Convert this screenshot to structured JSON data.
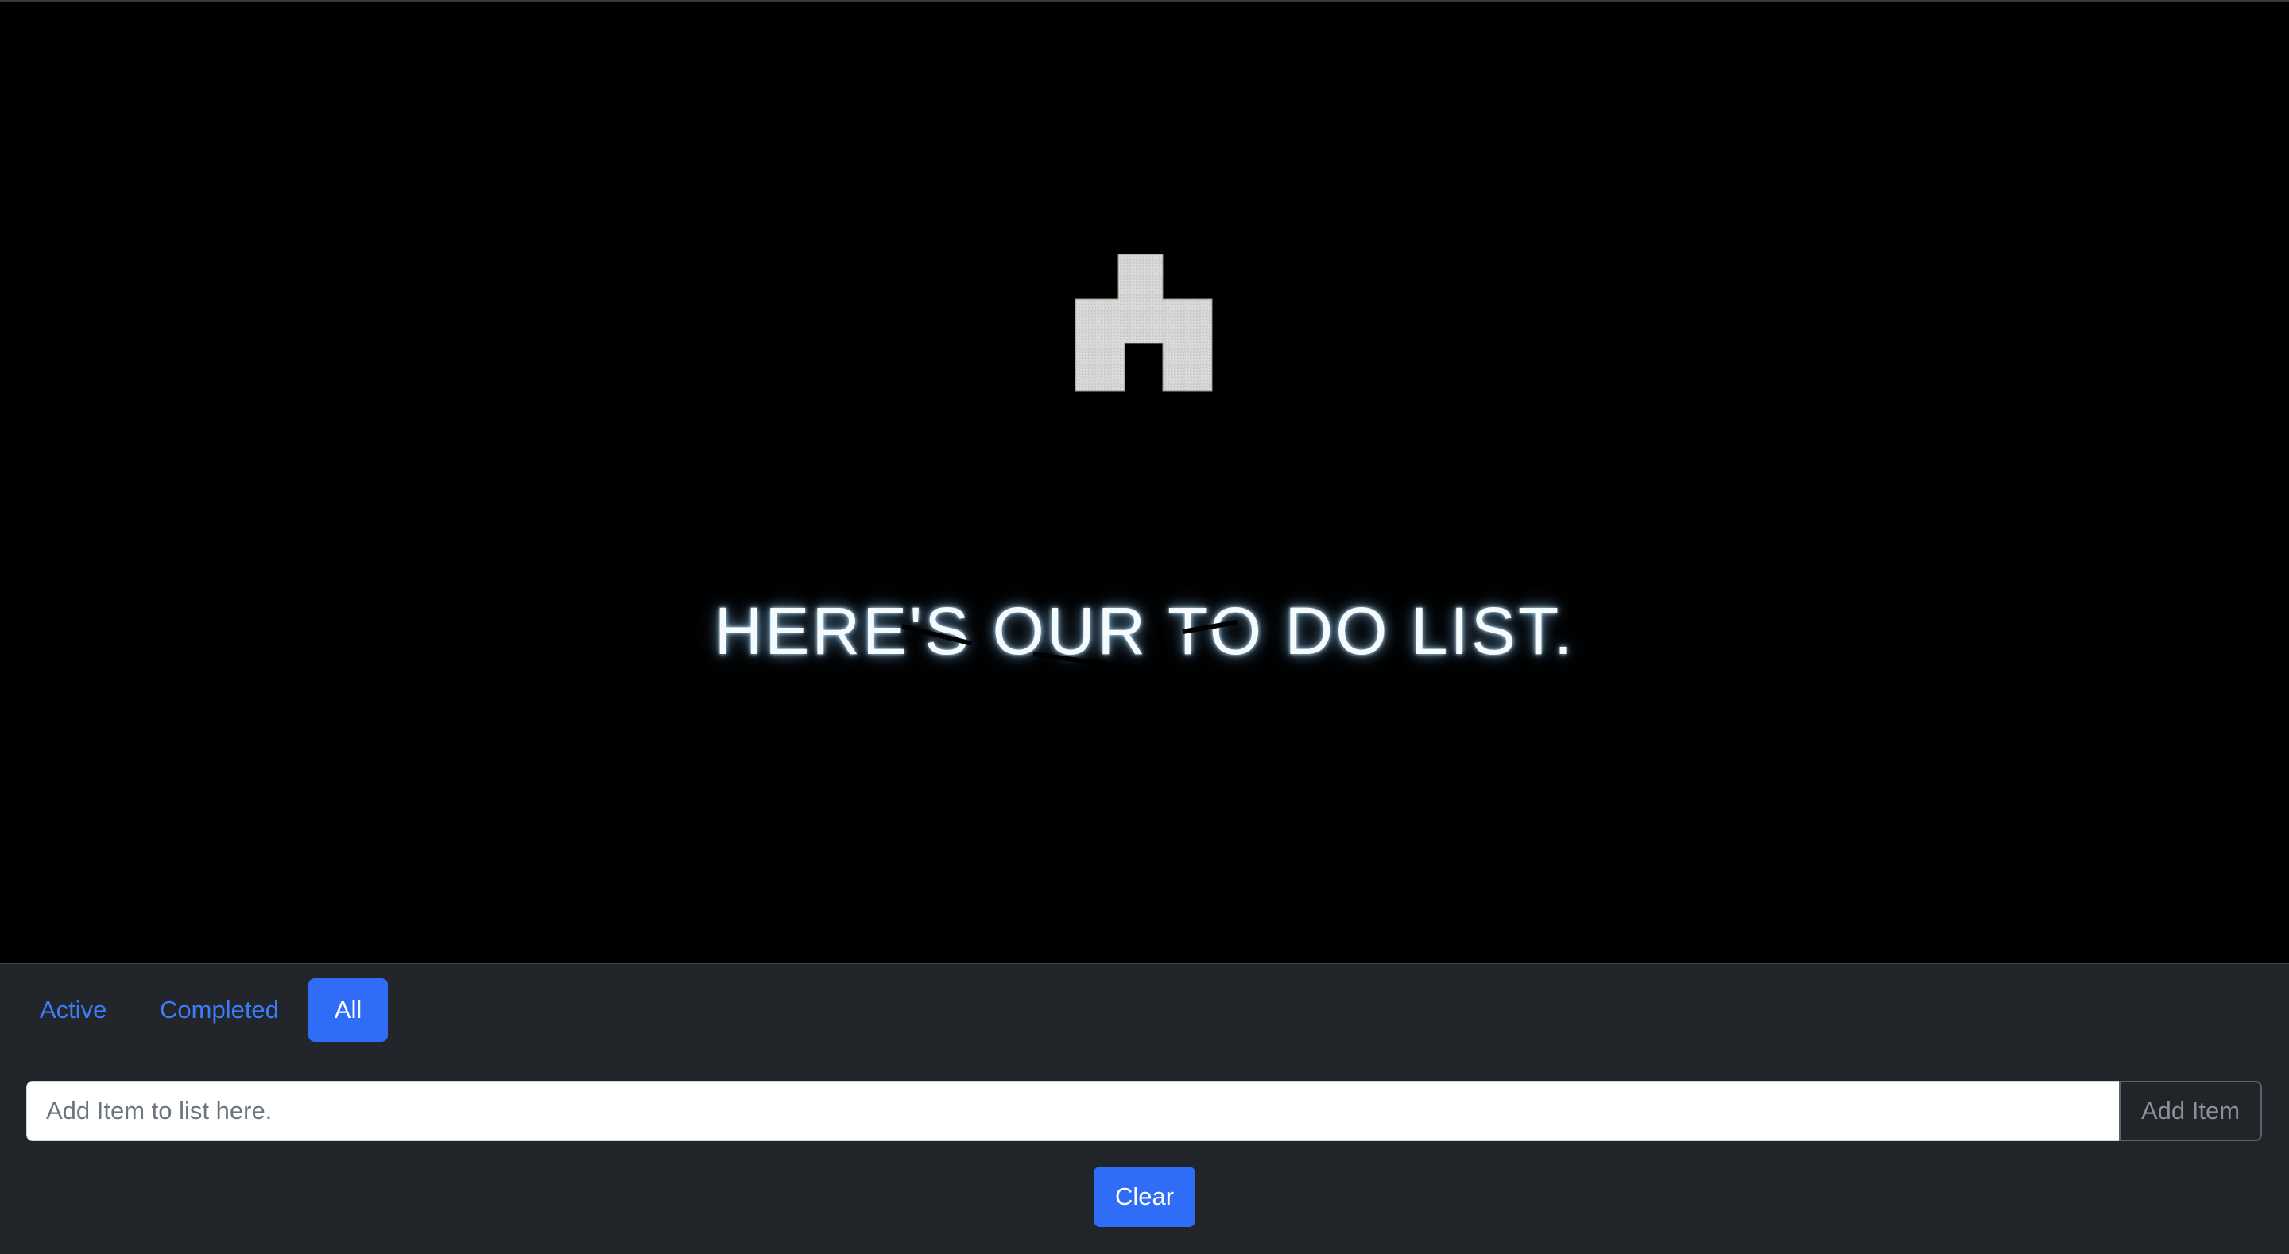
{
  "hero": {
    "logo_icon": "building-arch-icon",
    "headline": "HERE'S OUR TO DO LIST."
  },
  "filters": {
    "tabs": [
      {
        "label": "Active",
        "selected": false
      },
      {
        "label": "Completed",
        "selected": false
      },
      {
        "label": "All",
        "selected": true
      }
    ]
  },
  "add_item": {
    "placeholder": "Add Item to list here.",
    "value": "",
    "button_label": "Add Item"
  },
  "actions": {
    "clear_label": "Clear"
  },
  "colors": {
    "accent": "#2f6df6",
    "link": "#3d7cf6",
    "panel_bg": "#212529",
    "hero_bg": "#000000"
  }
}
